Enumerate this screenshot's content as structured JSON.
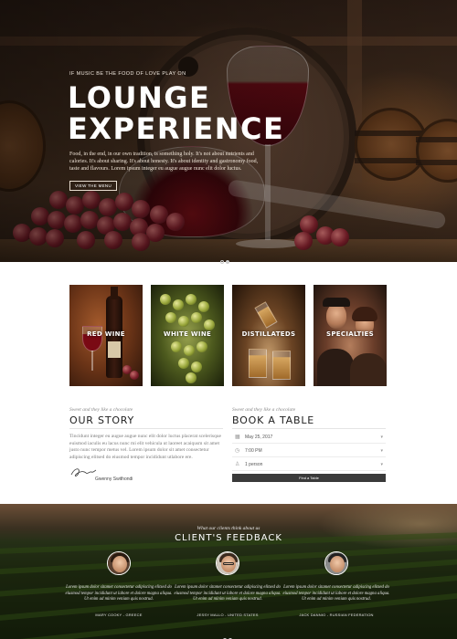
{
  "hero": {
    "eyebrow": "IF MUSIC BE THE FOOD OF LOVE PLAY ON",
    "title_line1": "LOUNGE",
    "title_line2": "EXPERIENCE",
    "text": "Food, in the end, in our own tradition, is something holy. It's not about nutrients and calories. It's about sharing. It's about honesty. It's about identity and gastronomy food, taste and flavours. Lorem ipsum integer eu augue augue nunc elit dolor luctus.",
    "button_label": "VIEW THE MENU",
    "slides": 2,
    "active_slide": 0
  },
  "categories": [
    {
      "label": "RED WINE"
    },
    {
      "label": "WHITE WINE"
    },
    {
      "label": "DISTILLATEDS"
    },
    {
      "label": "SPECIALTIES"
    }
  ],
  "story": {
    "kicker": "Sweet and they like a chocolate",
    "title": "OUR STORY",
    "text": "Tincidunt integer eu augue augue nunc elit dolor luctus placerat scelerisque euismod iaculis eu lacus nunc mi elit vehicula ut laoreet acaiqusm sit amet justo nunc tempor metus vel. Lorem ipsum dolor sit amet consectetur adipiscing elitsed do eiusmod tempor incididunt utlabore ere.",
    "signature_name": "Gwenny Swithondi"
  },
  "booking": {
    "kicker": "Sweet and they like a chocolate",
    "title": "BOOK A TABLE",
    "date_value": "May 25, 2017",
    "time_value": "7:00 PM",
    "people_value": "1 person",
    "button_label": "Find a Table",
    "icons": {
      "date": "calendar-icon",
      "time": "clock-icon",
      "people": "user-icon"
    }
  },
  "feedback": {
    "kicker": "What our clients think about us",
    "title": "CLIENT'S FEEDBACK",
    "items": [
      {
        "quote": "Lorem ipsum dolor sitamet consectetur adipiscing elitsed do eiusmod tempor incididunt ut labore et dolore magna aliqua. Ut enim ad minim veniam quis nostrud.",
        "author": "MARY COOKY - GREECE"
      },
      {
        "quote": "Lorem ipsum dolor sitamet consectetur adipiscing elitsed do eiusmod tempor incididunt ut labore et dolore magna aliqua. Ut enim ad minim veniam quis nostrud.",
        "author": "JESSY MALLO - UNITED STATES"
      },
      {
        "quote": "Lorem ipsum dolor sitamet consectetur adipiscing elitsed do eiusmod tempor incididunt ut labore et dolore magna aliqua. Ut enim ad minim veniam quis nostrud.",
        "author": "JACK DANNIO - RUSSIAN FEDERATION"
      }
    ],
    "slides": 2,
    "active_slide": 0
  }
}
